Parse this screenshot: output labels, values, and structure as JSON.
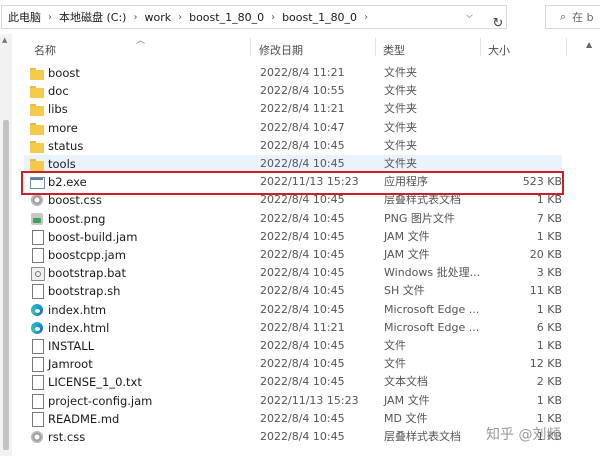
{
  "address_bar": {
    "breadcrumbs": [
      "此电脑",
      "本地磁盘 (C:)",
      "work",
      "boost_1_80_0",
      "boost_1_80_0"
    ],
    "search_placeholder": "在 b"
  },
  "columns": {
    "name": "名称",
    "date": "修改日期",
    "type": "类型",
    "size": "大小"
  },
  "files": [
    {
      "name": "boost",
      "date": "2022/8/4 11:21",
      "type": "文件夹",
      "size": "",
      "icon": "folder-icon"
    },
    {
      "name": "doc",
      "date": "2022/8/4 10:55",
      "type": "文件夹",
      "size": "",
      "icon": "folder-icon"
    },
    {
      "name": "libs",
      "date": "2022/8/4 11:21",
      "type": "文件夹",
      "size": "",
      "icon": "folder-icon"
    },
    {
      "name": "more",
      "date": "2022/8/4 10:47",
      "type": "文件夹",
      "size": "",
      "icon": "folder-icon"
    },
    {
      "name": "status",
      "date": "2022/8/4 10:45",
      "type": "文件夹",
      "size": "",
      "icon": "folder-icon"
    },
    {
      "name": "tools",
      "date": "2022/8/4 10:45",
      "type": "文件夹",
      "size": "",
      "icon": "folder-icon"
    },
    {
      "name": "b2.exe",
      "date": "2022/11/13 15:23",
      "type": "应用程序",
      "size": "523 KB",
      "icon": "exe-icon"
    },
    {
      "name": "boost.css",
      "date": "2022/8/4 10:45",
      "type": "层叠样式表文档",
      "size": "1 KB",
      "icon": "css-icon"
    },
    {
      "name": "boost.png",
      "date": "2022/8/4 10:45",
      "type": "PNG 图片文件",
      "size": "7 KB",
      "icon": "png-icon"
    },
    {
      "name": "boost-build.jam",
      "date": "2022/8/4 10:45",
      "type": "JAM 文件",
      "size": "1 KB",
      "icon": "document-icon"
    },
    {
      "name": "boostcpp.jam",
      "date": "2022/8/4 10:45",
      "type": "JAM 文件",
      "size": "20 KB",
      "icon": "document-icon"
    },
    {
      "name": "bootstrap.bat",
      "date": "2022/8/4 10:45",
      "type": "Windows 批处理...",
      "size": "3 KB",
      "icon": "batch-icon"
    },
    {
      "name": "bootstrap.sh",
      "date": "2022/8/4 10:45",
      "type": "SH 文件",
      "size": "11 KB",
      "icon": "document-icon"
    },
    {
      "name": "index.htm",
      "date": "2022/8/4 10:45",
      "type": "Microsoft Edge ...",
      "size": "1 KB",
      "icon": "edge-icon"
    },
    {
      "name": "index.html",
      "date": "2022/8/4 11:21",
      "type": "Microsoft Edge ...",
      "size": "6 KB",
      "icon": "edge-icon"
    },
    {
      "name": "INSTALL",
      "date": "2022/8/4 10:45",
      "type": "文件",
      "size": "1 KB",
      "icon": "document-icon"
    },
    {
      "name": "Jamroot",
      "date": "2022/8/4 10:45",
      "type": "文件",
      "size": "12 KB",
      "icon": "document-icon"
    },
    {
      "name": "LICENSE_1_0.txt",
      "date": "2022/8/4 10:45",
      "type": "文本文档",
      "size": "2 KB",
      "icon": "document-icon"
    },
    {
      "name": "project-config.jam",
      "date": "2022/11/13 15:23",
      "type": "JAM 文件",
      "size": "1 KB",
      "icon": "document-icon"
    },
    {
      "name": "README.md",
      "date": "2022/8/4 10:45",
      "type": "MD 文件",
      "size": "1 KB",
      "icon": "document-icon"
    },
    {
      "name": "rst.css",
      "date": "2022/8/4 10:45",
      "type": "层叠样式表文档",
      "size": "1 KB",
      "icon": "css-icon"
    }
  ],
  "selected_row": 5,
  "highlighted_row": 6,
  "highlight_color": "#cc2029",
  "selection_color": "#eaf3fc",
  "watermark": "知乎 @刘频"
}
